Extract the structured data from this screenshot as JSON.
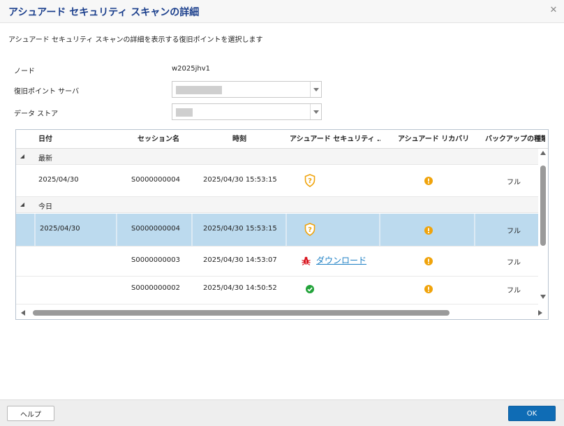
{
  "dialog": {
    "title": "アシュアード セキュリティ スキャンの詳細",
    "close_label": "✕",
    "instruction": "アシュアード セキュリティ スキャンの詳細を表示する復旧ポイントを選択します"
  },
  "form": {
    "node_label": "ノード",
    "node_value": "w2025jhv1",
    "rps_label": "復旧ポイント サーバ",
    "datastore_label": "データ ストア"
  },
  "grid": {
    "columns": [
      "日付",
      "セッション名",
      "時刻",
      "アシュアード セキュリティ …",
      "アシュアード リカバリ",
      "バックアップの種類"
    ],
    "groups": [
      {
        "label": "最新",
        "rows": [
          {
            "date": "2025/04/30",
            "session": "S0000000004",
            "time": "2025/04/30 15:53:15",
            "security": "pending-shield",
            "recovery": "warning",
            "type": "フル"
          }
        ]
      },
      {
        "label": "今日",
        "rows": [
          {
            "date": "2025/04/30",
            "session": "S0000000004",
            "time": "2025/04/30 15:53:15",
            "security": "pending-shield",
            "recovery": "warning",
            "type": "フル",
            "selected": true
          },
          {
            "date": "",
            "session": "S0000000003",
            "time": "2025/04/30 14:53:07",
            "security": "threat-download",
            "security_link": "ダウンロード",
            "recovery": "warning",
            "type": "フル"
          },
          {
            "date": "",
            "session": "S0000000002",
            "time": "2025/04/30 14:50:52",
            "security": "success-check",
            "recovery": "warning",
            "type": "フル"
          }
        ]
      }
    ]
  },
  "footer": {
    "help_label": "ヘルプ",
    "ok_label": "OK"
  },
  "colors": {
    "title": "#1a3e8c",
    "selected_row": "#bcdaee",
    "warning": "#f0a30a",
    "success": "#22a33a",
    "threat": "#d9141e",
    "link": "#1c7fc4",
    "ok_button": "#0f6cb5"
  }
}
